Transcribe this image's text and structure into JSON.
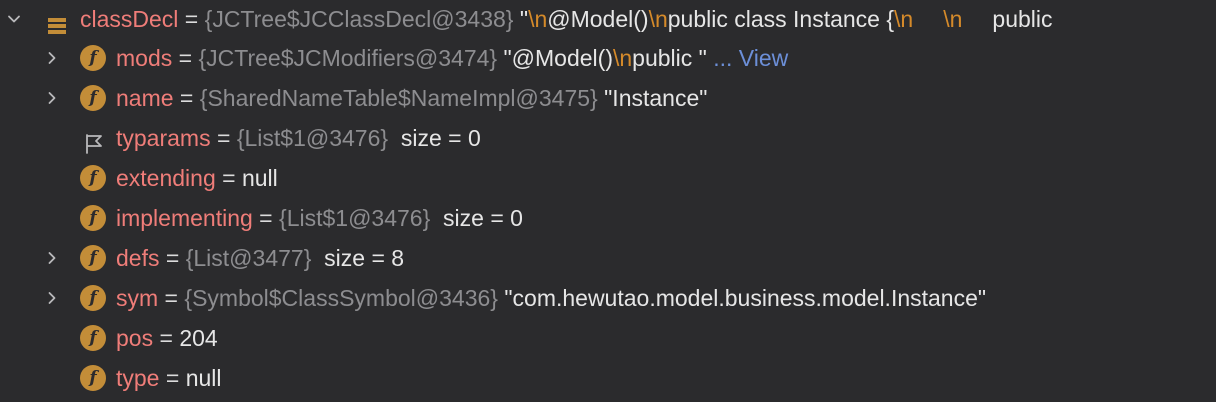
{
  "rows": [
    {
      "name": "classDecl",
      "eq": " = ",
      "ref": "{JCTree$JCClassDecl@3438}",
      "value_parts": [
        " \"",
        "\\n",
        "@Model()",
        "\\n",
        "public class Instance {",
        "\\n",
        "\\n",
        "public"
      ]
    },
    {
      "name": "mods",
      "eq": " = ",
      "ref": "{JCTree$JCModifiers@3474}",
      "value_parts": [
        " \"@Model()",
        "\\n",
        "public \" "
      ],
      "link": "... View"
    },
    {
      "name": "name",
      "eq": " = ",
      "ref": "{SharedNameTable$NameImpl@3475}",
      "value": " \"Instance\""
    },
    {
      "name": "typarams",
      "eq": " = ",
      "ref": "{List$1@3476}",
      "value": "  size = 0"
    },
    {
      "name": "extending",
      "eq": " = ",
      "value": "null"
    },
    {
      "name": "implementing",
      "eq": " = ",
      "ref": "{List$1@3476}",
      "value": "  size = 0"
    },
    {
      "name": "defs",
      "eq": " = ",
      "ref": "{List@3477}",
      "value": "  size = 8"
    },
    {
      "name": "sym",
      "eq": " = ",
      "ref": "{Symbol$ClassSymbol@3436}",
      "value": " \"com.hewutao.model.business.model.Instance\""
    },
    {
      "name": "pos",
      "eq": " = ",
      "value": "204"
    },
    {
      "name": "type",
      "eq": " = ",
      "value": "null"
    }
  ],
  "icons": {
    "field_letter": "f",
    "expand": "chevron-right-icon",
    "collapse": "chevron-down-icon",
    "struct": "object-icon",
    "flag": "flag-icon"
  },
  "colors": {
    "background": "#2b2b2d",
    "field_name": "#ef7d79",
    "reference": "#8d8d90",
    "value": "#e6e6e6",
    "escape": "#d58a2a",
    "link": "#6c8fd8",
    "field_icon": "#c38d38"
  }
}
